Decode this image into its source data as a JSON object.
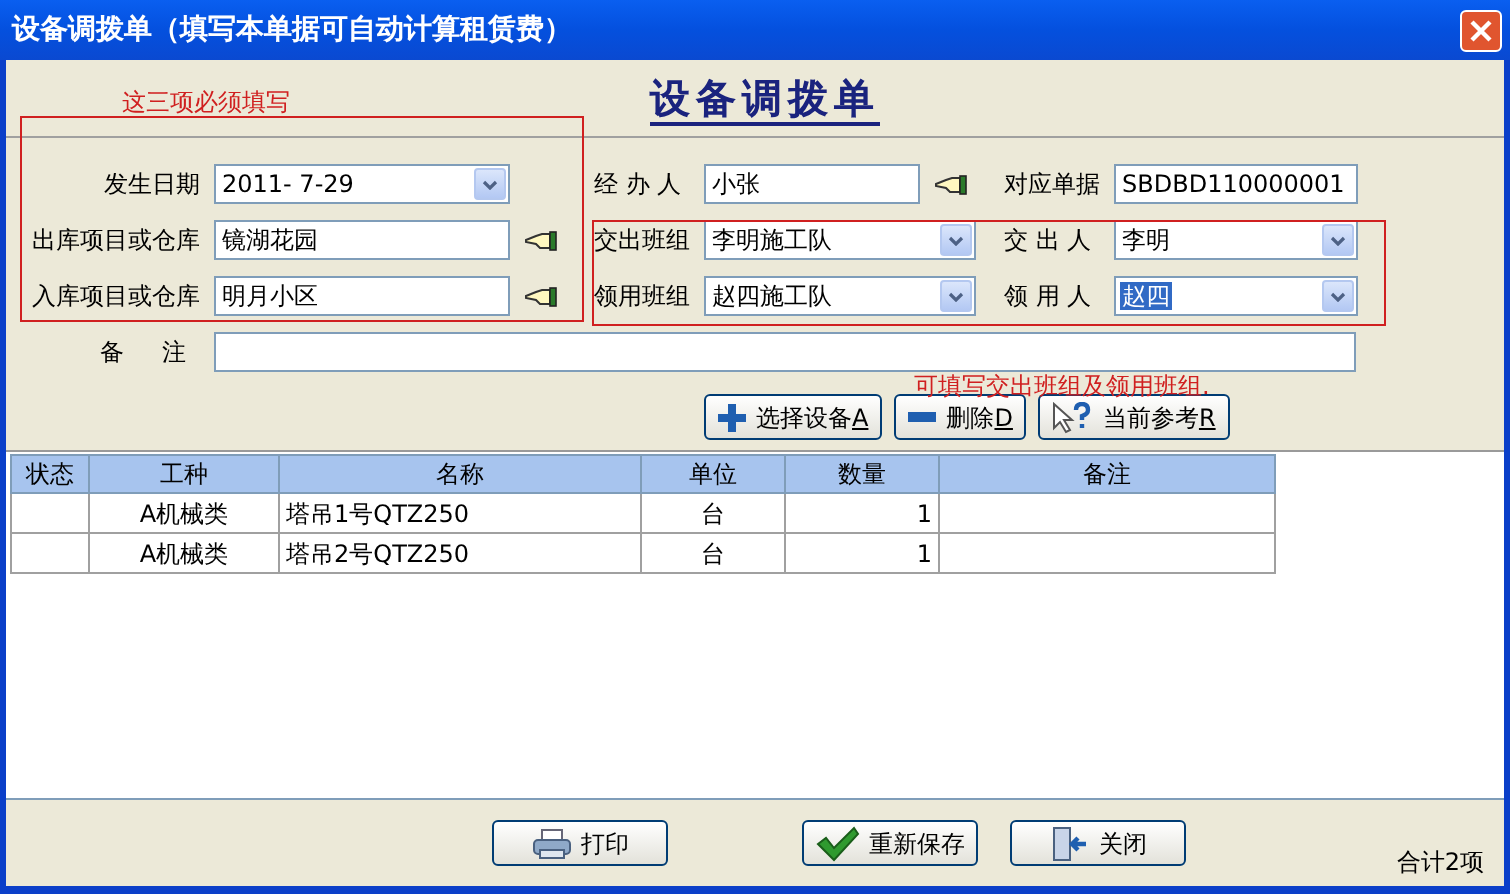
{
  "window": {
    "title": "设备调拨单（填写本单据可自动计算租赁费）"
  },
  "form": {
    "heading": "设备调拨单",
    "notes": [
      {
        "text": "这三项必须填写",
        "kind": "left"
      },
      {
        "text": "可填写交出班组及领用班组.",
        "kind": "right"
      }
    ],
    "rows": [
      [
        {
          "label": "发生日期",
          "value": "2011- 7-29",
          "kind": "combo",
          "lookup": false,
          "highlighted": false
        },
        {
          "label": "经 办 人",
          "value": "小张",
          "kind": "text",
          "lookup": true,
          "highlighted": false
        },
        {
          "label": "对应单据",
          "value": "SBDBD110000001",
          "kind": "text",
          "lookup": false,
          "highlighted": false
        }
      ],
      [
        {
          "label": "出库项目或仓库",
          "value": "镜湖花园",
          "kind": "text",
          "lookup": true,
          "highlighted": false
        },
        {
          "label": "交出班组",
          "value": "李明施工队",
          "kind": "combo",
          "lookup": false,
          "highlighted": false
        },
        {
          "label": "交 出 人",
          "value": "李明",
          "kind": "combo",
          "lookup": false,
          "highlighted": false
        }
      ],
      [
        {
          "label": "入库项目或仓库",
          "value": "明月小区",
          "kind": "text",
          "lookup": true,
          "highlighted": false
        },
        {
          "label": "领用班组",
          "value": "赵四施工队",
          "kind": "combo",
          "lookup": false,
          "highlighted": false
        },
        {
          "label": "领 用 人",
          "value": "赵四",
          "kind": "combo",
          "lookup": false,
          "highlighted": true
        }
      ]
    ],
    "remark": {
      "label": "备     注"
    },
    "buttons": [
      {
        "label": "选择设备",
        "accel": "A",
        "kind": "add"
      },
      {
        "label": "删除",
        "accel": "D",
        "kind": "remove"
      },
      {
        "label": "当前参考",
        "accel": "R",
        "kind": "help"
      }
    ]
  },
  "table": {
    "columns": [
      "状态",
      "工种",
      "名称",
      "单位",
      "数量",
      "备注"
    ],
    "rows": [
      [
        "",
        "A机械类",
        "塔吊1号QTZ250",
        "台",
        "1",
        ""
      ],
      [
        "",
        "A机械类",
        "塔吊2号QTZ250",
        "台",
        "1",
        ""
      ]
    ]
  },
  "footer": {
    "buttons": [
      {
        "label": "打印",
        "kind": "print"
      },
      {
        "label": "重新保存",
        "kind": "save"
      },
      {
        "label": "关闭",
        "kind": "close"
      }
    ],
    "status": "合计2项"
  }
}
